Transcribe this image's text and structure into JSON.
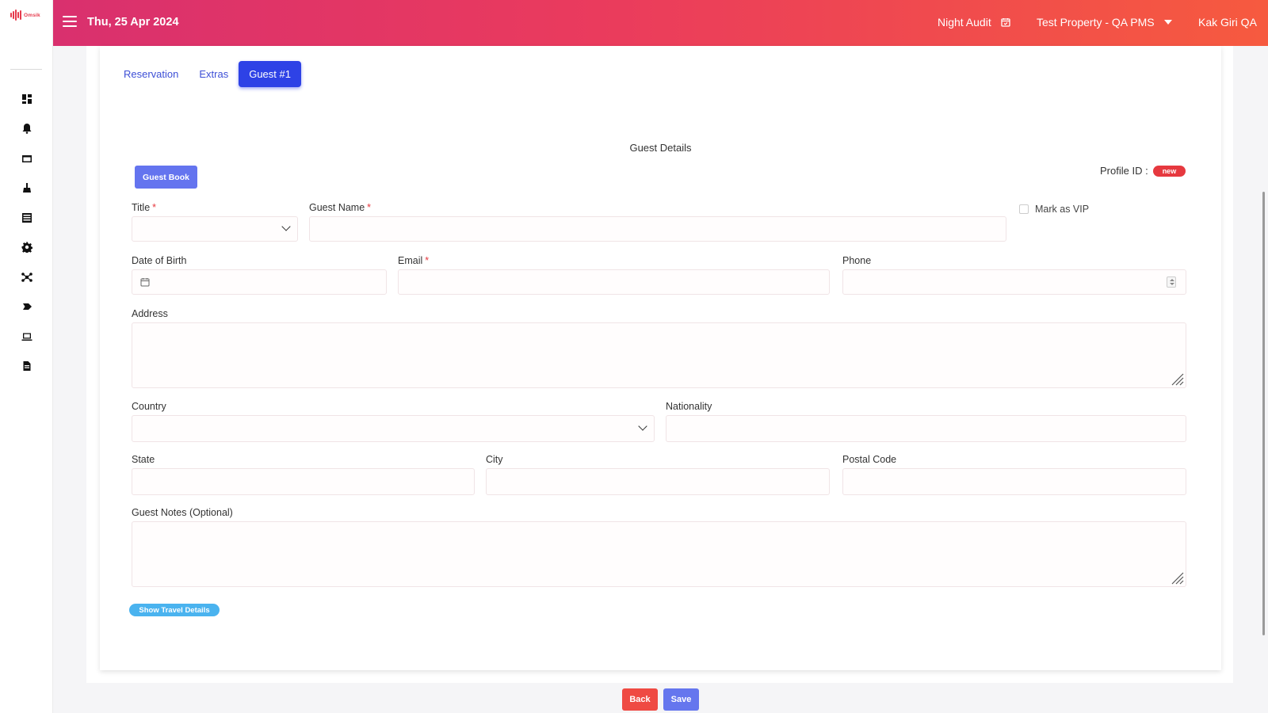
{
  "app": {
    "logo_text": "Omsik",
    "date": "Thu, 25 Apr 2024",
    "night_audit": "Night Audit",
    "property": "Test Property - QA PMS",
    "user": "Kak Giri QA",
    "brand_colors": {
      "gradient_start": "#d9306e",
      "gradient_end": "#f65a3f",
      "primary": "#2e42e6"
    }
  },
  "sidebar": {
    "icons": [
      "dashboard-icon",
      "bell-icon",
      "folder-icon",
      "housekeeping-icon",
      "list-icon",
      "settings-icon",
      "network-icon",
      "tag-icon",
      "laptop-icon",
      "report-icon"
    ]
  },
  "tabs": [
    {
      "label": "Reservation",
      "active": false
    },
    {
      "label": "Extras",
      "active": false
    },
    {
      "label": "Guest #1",
      "active": true
    }
  ],
  "form": {
    "title": "Guest Details",
    "guest_book": "Guest Book",
    "profile_label": "Profile ID :",
    "profile_badge": "new",
    "mark_vip": "Mark as VIP",
    "fields": {
      "title": {
        "label": "Title",
        "required": "*",
        "value": ""
      },
      "guest_name": {
        "label": "Guest Name",
        "required": "*",
        "value": ""
      },
      "dob": {
        "label": "Date of Birth",
        "value": ""
      },
      "email": {
        "label": "Email",
        "required": "*",
        "value": ""
      },
      "phone": {
        "label": "Phone",
        "value": ""
      },
      "address": {
        "label": "Address",
        "value": ""
      },
      "country": {
        "label": "Country",
        "value": ""
      },
      "nationality": {
        "label": "Nationality",
        "value": ""
      },
      "state": {
        "label": "State",
        "value": ""
      },
      "city": {
        "label": "City",
        "value": ""
      },
      "postal_code": {
        "label": "Postal Code",
        "value": ""
      },
      "notes": {
        "label": "Guest Notes (Optional)",
        "value": ""
      }
    },
    "travel_button": "Show Travel Details"
  },
  "footer": {
    "back": "Back",
    "save": "Save"
  }
}
